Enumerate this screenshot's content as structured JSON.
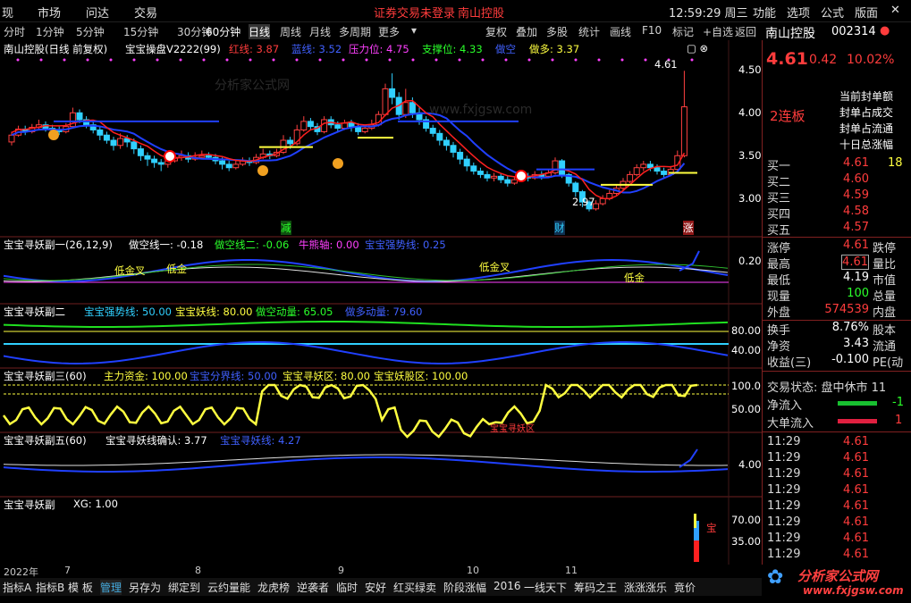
{
  "menu": {
    "items": [
      "现",
      "市场",
      "问达",
      "交易"
    ],
    "notice": "证券交易未登录",
    "stock_short": "南山控股",
    "clock": "12:59:29 周三",
    "right_items": [
      "功能",
      "选项",
      "公式",
      "版面"
    ]
  },
  "periods": [
    "分时",
    "1分钟",
    "5分钟",
    "15分钟",
    "30分钟",
    "60分钟",
    "日线",
    "周线",
    "月线",
    "多周期",
    "更多"
  ],
  "active_period": "日线",
  "tools": [
    "复权",
    "叠加",
    "多股",
    "统计",
    "画线",
    "F10",
    "标记",
    "+自选",
    "返回"
  ],
  "main": {
    "title": "南山控股(日线 前复权)",
    "indicator": "宝宝操盘V2222(99)",
    "red_line": "红线: 3.87",
    "blue_line": "蓝线: 3.52",
    "pressure": "压力位: 4.75",
    "support": "支撑位: 4.33",
    "do_empty": "做空",
    "do_more": "做多: 3.37",
    "price_labels": [
      "4.50",
      "4.00",
      "3.50",
      "3.00"
    ],
    "high_mark": "4.61",
    "low_mark": "2.97",
    "bottom_tags": [
      "减",
      "财",
      "涨"
    ],
    "candles": [
      [
        3.78,
        3.86,
        3.74,
        3.9
      ],
      [
        3.86,
        3.93,
        3.84,
        3.97
      ],
      [
        3.93,
        3.9,
        3.86,
        3.97
      ],
      [
        3.9,
        3.95,
        3.88,
        3.99
      ],
      [
        3.95,
        3.98,
        3.92,
        4.04
      ],
      [
        3.98,
        3.94,
        3.9,
        4.02
      ],
      [
        3.94,
        3.92,
        3.88,
        3.98
      ],
      [
        3.92,
        3.9,
        3.86,
        3.96
      ],
      [
        3.9,
        3.96,
        3.88,
        4.0
      ],
      [
        3.96,
        4.12,
        3.94,
        4.18
      ],
      [
        4.12,
        4.04,
        4.0,
        4.16
      ],
      [
        4.04,
        3.98,
        3.94,
        4.08
      ],
      [
        3.98,
        3.92,
        3.88,
        4.02
      ],
      [
        3.92,
        3.86,
        3.8,
        3.96
      ],
      [
        3.86,
        3.8,
        3.76,
        3.9
      ],
      [
        3.8,
        3.74,
        3.68,
        3.84
      ],
      [
        3.74,
        3.82,
        3.7,
        3.88
      ],
      [
        3.82,
        3.78,
        3.72,
        3.86
      ],
      [
        3.78,
        3.7,
        3.64,
        3.82
      ],
      [
        3.7,
        3.62,
        3.56,
        3.74
      ],
      [
        3.62,
        3.58,
        3.5,
        3.66
      ],
      [
        3.58,
        3.54,
        3.48,
        3.62
      ],
      [
        3.54,
        3.52,
        3.44,
        3.58
      ],
      [
        3.52,
        3.56,
        3.48,
        3.62
      ],
      [
        3.56,
        3.6,
        3.54,
        3.64
      ],
      [
        3.6,
        3.62,
        3.56,
        3.68
      ],
      [
        3.62,
        3.58,
        3.54,
        3.66
      ],
      [
        3.58,
        3.6,
        3.56,
        3.66
      ],
      [
        3.6,
        3.62,
        3.58,
        3.68
      ],
      [
        3.62,
        3.6,
        3.58,
        3.66
      ],
      [
        3.6,
        3.56,
        3.52,
        3.64
      ],
      [
        3.56,
        3.52,
        3.46,
        3.6
      ],
      [
        3.52,
        3.48,
        3.44,
        3.56
      ],
      [
        3.48,
        3.52,
        3.46,
        3.56
      ],
      [
        3.52,
        3.56,
        3.5,
        3.6
      ],
      [
        3.56,
        3.54,
        3.5,
        3.6
      ],
      [
        3.54,
        3.6,
        3.52,
        3.64
      ],
      [
        3.6,
        3.64,
        3.58,
        3.7
      ],
      [
        3.64,
        3.62,
        3.58,
        3.68
      ],
      [
        3.62,
        3.66,
        3.6,
        3.7
      ],
      [
        3.66,
        3.8,
        3.64,
        3.86
      ],
      [
        3.8,
        3.76,
        3.7,
        3.84
      ],
      [
        3.76,
        3.92,
        3.74,
        3.98
      ],
      [
        3.92,
        4.02,
        3.9,
        4.08
      ],
      [
        4.02,
        3.96,
        3.92,
        4.06
      ],
      [
        3.96,
        3.9,
        3.86,
        4.0
      ],
      [
        3.9,
        4.04,
        3.88,
        4.08
      ],
      [
        4.04,
        3.98,
        3.94,
        4.08
      ],
      [
        3.98,
        3.94,
        3.9,
        4.02
      ],
      [
        3.94,
        4.0,
        3.92,
        4.04
      ],
      [
        4.0,
        3.96,
        3.9,
        4.04
      ],
      [
        3.96,
        3.9,
        3.86,
        4.0
      ],
      [
        3.9,
        3.94,
        3.88,
        3.98
      ],
      [
        3.94,
        3.98,
        3.92,
        4.04
      ],
      [
        3.98,
        4.1,
        3.96,
        4.14
      ],
      [
        4.1,
        4.4,
        4.08,
        4.46
      ],
      [
        4.4,
        4.3,
        4.22,
        4.58
      ],
      [
        4.3,
        4.1,
        4.04,
        4.36
      ],
      [
        4.1,
        4.24,
        4.06,
        4.4
      ],
      [
        4.24,
        4.12,
        4.06,
        4.3
      ],
      [
        4.12,
        4.04,
        3.98,
        4.18
      ],
      [
        4.04,
        3.94,
        3.9,
        4.08
      ],
      [
        3.94,
        3.88,
        3.84,
        3.98
      ],
      [
        3.88,
        3.8,
        3.74,
        3.92
      ],
      [
        3.8,
        3.74,
        3.68,
        3.84
      ],
      [
        3.74,
        3.66,
        3.6,
        3.78
      ],
      [
        3.66,
        3.58,
        3.52,
        3.7
      ],
      [
        3.58,
        3.5,
        3.44,
        3.62
      ],
      [
        3.5,
        3.44,
        3.4,
        3.54
      ],
      [
        3.44,
        3.4,
        3.36,
        3.48
      ],
      [
        3.4,
        3.36,
        3.32,
        3.44
      ],
      [
        3.36,
        3.38,
        3.32,
        3.42
      ],
      [
        3.38,
        3.34,
        3.3,
        3.42
      ],
      [
        3.34,
        3.3,
        3.26,
        3.38
      ],
      [
        3.3,
        3.34,
        3.28,
        3.38
      ],
      [
        3.34,
        3.38,
        3.32,
        3.42
      ],
      [
        3.38,
        3.36,
        3.32,
        3.42
      ],
      [
        3.36,
        3.4,
        3.34,
        3.44
      ],
      [
        3.4,
        3.38,
        3.34,
        3.44
      ],
      [
        3.38,
        3.42,
        3.36,
        3.46
      ],
      [
        3.42,
        3.56,
        3.4,
        3.6
      ],
      [
        3.56,
        3.4,
        3.36,
        3.58
      ],
      [
        3.4,
        3.3,
        3.26,
        3.42
      ],
      [
        3.3,
        3.2,
        3.14,
        3.32
      ],
      [
        3.2,
        3.08,
        3.02,
        3.22
      ],
      [
        3.08,
        3.0,
        2.97,
        3.1
      ],
      [
        3.0,
        3.06,
        2.98,
        3.1
      ],
      [
        3.06,
        3.12,
        3.04,
        3.16
      ],
      [
        3.12,
        3.18,
        3.1,
        3.22
      ],
      [
        3.18,
        3.24,
        3.16,
        3.28
      ],
      [
        3.24,
        3.32,
        3.22,
        3.36
      ],
      [
        3.32,
        3.4,
        3.3,
        3.44
      ],
      [
        3.4,
        3.48,
        3.38,
        3.52
      ],
      [
        3.48,
        3.52,
        3.44,
        3.56
      ],
      [
        3.52,
        3.48,
        3.44,
        3.56
      ],
      [
        3.48,
        3.44,
        3.4,
        3.52
      ],
      [
        3.44,
        3.4,
        3.36,
        3.48
      ],
      [
        3.4,
        3.46,
        3.38,
        3.5
      ],
      [
        3.46,
        3.62,
        3.44,
        3.68
      ],
      [
        3.62,
        4.19,
        3.6,
        4.61
      ]
    ]
  },
  "sub1": {
    "title": "宝宝寻妖副一(26,12,9)",
    "l1": "做空线一: -0.18",
    "l2": "做空线二: -0.06",
    "l3": "牛熊轴: 0.00",
    "l4": "宝宝强势线: 0.25",
    "tick": "0.20",
    "tags": [
      "低金叉",
      "低金",
      "低金叉",
      "低金"
    ]
  },
  "sub2": {
    "title": "宝宝寻妖副二",
    "l1": "宝宝强势线: 50.00",
    "l2": "宝宝妖线: 80.00",
    "l3": "做空动量: 65.05",
    "l4": "做多动量: 79.60",
    "ticks": [
      "80.00",
      "40.00"
    ]
  },
  "sub3": {
    "title": "宝宝寻妖副三(60)",
    "l1": "主力资金: 100.00",
    "l2": "宝宝分界线: 50.00",
    "l3": "宝宝寻妖区: 80.00",
    "l4": "宝宝妖股区: 100.00",
    "ticks": [
      "100.0",
      "50.00"
    ],
    "tag": "宝宝寻妖区"
  },
  "sub4": {
    "title": "宝宝寻妖副五(60)",
    "l1": "宝宝寻妖线确认: 3.77",
    "l2": "宝宝寻妖线: 4.27",
    "tick": "4.00"
  },
  "sub5": {
    "title": "宝宝寻妖副",
    "l1": "XG: 1.00",
    "ticks": [
      "70.00",
      "35.00"
    ],
    "tag": "宝"
  },
  "dates": [
    "2022年",
    "7",
    "8",
    "9",
    "10",
    "11"
  ],
  "bottom_tabs": [
    "指标A",
    "指标B",
    "模 板",
    "管理",
    "另存为",
    "绑定到",
    "云约量能",
    "龙虎榜",
    "逆袭者",
    "临时",
    "安好",
    "红买绿卖",
    "阶段涨幅",
    "2016",
    "一线天下",
    "筹码之王",
    "涨涨涨乐",
    "竟价"
  ],
  "quote": {
    "name": "南山控股",
    "code": "002314",
    "price": "4.61",
    "change": "0.42",
    "pct": "10.02%",
    "limit_tag": "2连板",
    "seal_items": [
      "当前封单额",
      "封单占成交",
      "封单占流通",
      "十日总涨幅"
    ],
    "book": [
      {
        "k": "买一",
        "v": "4.61",
        "n": "18"
      },
      {
        "k": "买二",
        "v": "4.60",
        "n": ""
      },
      {
        "k": "买三",
        "v": "4.59",
        "n": ""
      },
      {
        "k": "买四",
        "v": "4.58",
        "n": ""
      },
      {
        "k": "买五",
        "v": "4.57",
        "n": ""
      }
    ],
    "stats": [
      {
        "k": "涨停",
        "v": "4.61",
        "k2": "跌停"
      },
      {
        "k": "最高",
        "v": "4.61",
        "k2": "量比"
      },
      {
        "k": "最低",
        "v": "4.19",
        "k2": "市值"
      },
      {
        "k": "现量",
        "v": "100",
        "k2": "总量"
      },
      {
        "k": "外盘",
        "v": "574539",
        "k2": "内盘"
      },
      {
        "k": "换手",
        "v": "8.76%",
        "k2": "股本"
      },
      {
        "k": "净资",
        "v": "3.43",
        "k2": "流通"
      },
      {
        "k": "收益(三)",
        "v": "-0.100",
        "k2": "PE(动"
      }
    ],
    "trade_status": "交易状态: 盘中休市 11",
    "net_in": "净流入",
    "big_in": "大单流入",
    "ticks": [
      {
        "t": "11:29",
        "p": "4.61"
      },
      {
        "t": "11:29",
        "p": "4.61"
      },
      {
        "t": "11:29",
        "p": "4.61"
      },
      {
        "t": "11:29",
        "p": "4.61"
      },
      {
        "t": "11:29",
        "p": "4.61"
      },
      {
        "t": "11:29",
        "p": "4.61"
      },
      {
        "t": "11:29",
        "p": "4.61"
      },
      {
        "t": "11:29",
        "p": "4.61"
      }
    ]
  },
  "watermark": "分析家公式网",
  "watermark_url": "www.fxjgsw.com"
}
